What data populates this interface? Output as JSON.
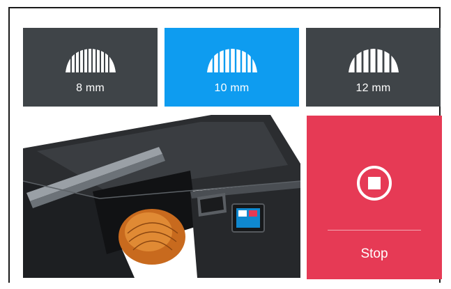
{
  "options": [
    {
      "label": "8 mm",
      "icon": "cut-slice-icon",
      "selected": false
    },
    {
      "label": "10 mm",
      "icon": "cut-slice-icon",
      "selected": true
    },
    {
      "label": "12 mm",
      "icon": "cut-slice-icon",
      "selected": false
    }
  ],
  "photo": {
    "name": "machine-photo"
  },
  "stop": {
    "label": "Stop",
    "icon": "stop-icon",
    "color": "#e63a55"
  },
  "colors": {
    "tile_dark": "#3f4448",
    "tile_active": "#0e9cf0",
    "stop": "#e63a55"
  }
}
